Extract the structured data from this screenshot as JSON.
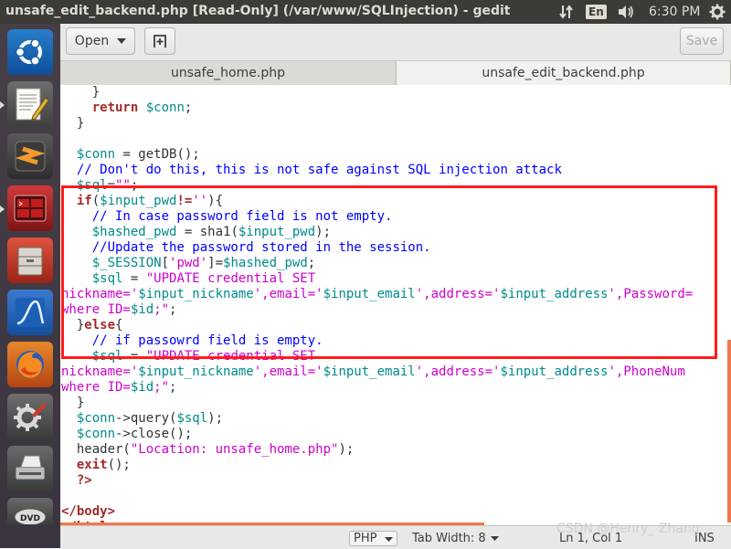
{
  "window": {
    "title": "unsafe_edit_backend.php [Read-Only] (/var/www/SQLInjection) - gedit"
  },
  "tray": {
    "network_icon": "updown-arrows-icon",
    "keyboard_label": "En",
    "volume_icon": "speaker-icon",
    "clock": "6:30 PM",
    "power_icon": "gear-icon"
  },
  "launcher": {
    "items": [
      {
        "name": "ubuntu-dash"
      },
      {
        "name": "text-editor"
      },
      {
        "name": "sublime-text"
      },
      {
        "name": "terminal"
      },
      {
        "name": "files"
      },
      {
        "name": "wireshark"
      },
      {
        "name": "firefox"
      },
      {
        "name": "system-settings"
      },
      {
        "name": "scanner"
      },
      {
        "name": "dvd"
      }
    ]
  },
  "toolbar": {
    "open_label": "Open",
    "new_tab_icon": "new-tab-icon",
    "save_label": "Save"
  },
  "tabs": [
    {
      "label": "unsafe_home.php"
    },
    {
      "label": "unsafe_edit_backend.php"
    }
  ],
  "code_lines": [
    [
      {
        "t": "    }",
        "c": "pl"
      }
    ],
    [
      {
        "t": "    ",
        "c": "pl"
      },
      {
        "t": "return",
        "c": "kw"
      },
      {
        "t": " ",
        "c": "pl"
      },
      {
        "t": "$conn",
        "c": "var"
      },
      {
        "t": ";",
        "c": "pl"
      }
    ],
    [
      {
        "t": "  }",
        "c": "pl"
      }
    ],
    [
      {
        "t": "",
        "c": "pl"
      }
    ],
    [
      {
        "t": "  ",
        "c": "pl"
      },
      {
        "t": "$conn",
        "c": "var"
      },
      {
        "t": " = getDB();",
        "c": "pl"
      }
    ],
    [
      {
        "t": "  ",
        "c": "pl"
      },
      {
        "t": "// Don't do this, this is not safe against SQL injection attack",
        "c": "cm"
      }
    ],
    [
      {
        "t": "  ",
        "c": "pl"
      },
      {
        "t": "$sql",
        "c": "var"
      },
      {
        "t": "=",
        "c": "pl"
      },
      {
        "t": "\"\"",
        "c": "str"
      },
      {
        "t": ";",
        "c": "pl"
      }
    ],
    [
      {
        "t": "  ",
        "c": "pl"
      },
      {
        "t": "if",
        "c": "kw"
      },
      {
        "t": "(",
        "c": "pl"
      },
      {
        "t": "$input_pwd",
        "c": "var"
      },
      {
        "t": "!=",
        "c": "kw"
      },
      {
        "t": "''",
        "c": "str"
      },
      {
        "t": "){",
        "c": "pl"
      }
    ],
    [
      {
        "t": "    ",
        "c": "pl"
      },
      {
        "t": "// In case password field is not empty.",
        "c": "cm"
      }
    ],
    [
      {
        "t": "    ",
        "c": "pl"
      },
      {
        "t": "$hashed_pwd",
        "c": "var"
      },
      {
        "t": " = sha1(",
        "c": "pl"
      },
      {
        "t": "$input_pwd",
        "c": "var"
      },
      {
        "t": ");",
        "c": "pl"
      }
    ],
    [
      {
        "t": "    ",
        "c": "pl"
      },
      {
        "t": "//Update the password stored in the session.",
        "c": "cm"
      }
    ],
    [
      {
        "t": "    ",
        "c": "pl"
      },
      {
        "t": "$_SESSION",
        "c": "var"
      },
      {
        "t": "[",
        "c": "pl"
      },
      {
        "t": "'pwd'",
        "c": "str"
      },
      {
        "t": "]=",
        "c": "pl"
      },
      {
        "t": "$hashed_pwd",
        "c": "var"
      },
      {
        "t": ";",
        "c": "pl"
      }
    ],
    [
      {
        "t": "    ",
        "c": "pl"
      },
      {
        "t": "$sql",
        "c": "var"
      },
      {
        "t": " = ",
        "c": "pl"
      },
      {
        "t": "\"UPDATE credential SET",
        "c": "str"
      }
    ],
    [
      {
        "t": "nickname='",
        "c": "str"
      },
      {
        "t": "$input_nickname",
        "c": "var"
      },
      {
        "t": "',email='",
        "c": "str"
      },
      {
        "t": "$input_email",
        "c": "var"
      },
      {
        "t": "',address='",
        "c": "str"
      },
      {
        "t": "$input_address",
        "c": "var"
      },
      {
        "t": "',Password=",
        "c": "str"
      }
    ],
    [
      {
        "t": "where ID=",
        "c": "str"
      },
      {
        "t": "$id",
        "c": "var"
      },
      {
        "t": ";\"",
        "c": "str"
      },
      {
        "t": ";",
        "c": "pl"
      }
    ],
    [
      {
        "t": "  }",
        "c": "pl"
      },
      {
        "t": "else",
        "c": "kw"
      },
      {
        "t": "{",
        "c": "pl"
      }
    ],
    [
      {
        "t": "    ",
        "c": "pl"
      },
      {
        "t": "// if passowrd field is empty.",
        "c": "cm"
      }
    ],
    [
      {
        "t": "    ",
        "c": "pl"
      },
      {
        "t": "$sql",
        "c": "var"
      },
      {
        "t": " = ",
        "c": "pl"
      },
      {
        "t": "\"UPDATE credential SET",
        "c": "str"
      }
    ],
    [
      {
        "t": "nickname='",
        "c": "str"
      },
      {
        "t": "$input_nickname",
        "c": "var"
      },
      {
        "t": "',email='",
        "c": "str"
      },
      {
        "t": "$input_email",
        "c": "var"
      },
      {
        "t": "',address='",
        "c": "str"
      },
      {
        "t": "$input_address",
        "c": "var"
      },
      {
        "t": "',PhoneNum",
        "c": "str"
      }
    ],
    [
      {
        "t": "where ID=",
        "c": "str"
      },
      {
        "t": "$id",
        "c": "var"
      },
      {
        "t": ";\"",
        "c": "str"
      },
      {
        "t": ";",
        "c": "pl"
      }
    ],
    [
      {
        "t": "  }",
        "c": "pl"
      }
    ],
    [
      {
        "t": "  ",
        "c": "pl"
      },
      {
        "t": "$conn",
        "c": "var"
      },
      {
        "t": "->query(",
        "c": "pl"
      },
      {
        "t": "$sql",
        "c": "var"
      },
      {
        "t": ");",
        "c": "pl"
      }
    ],
    [
      {
        "t": "  ",
        "c": "pl"
      },
      {
        "t": "$conn",
        "c": "var"
      },
      {
        "t": "->close();",
        "c": "pl"
      }
    ],
    [
      {
        "t": "  header(",
        "c": "pl"
      },
      {
        "t": "\"Location: unsafe_home.php\"",
        "c": "str"
      },
      {
        "t": ");",
        "c": "pl"
      }
    ],
    [
      {
        "t": "  ",
        "c": "pl"
      },
      {
        "t": "exit",
        "c": "kw"
      },
      {
        "t": "();",
        "c": "pl"
      }
    ],
    [
      {
        "t": "  ",
        "c": "pl"
      },
      {
        "t": "?>",
        "c": "kw"
      }
    ],
    [
      {
        "t": "",
        "c": "pl"
      }
    ],
    [
      {
        "t": "</body>",
        "c": "kw"
      }
    ],
    [
      {
        "t": "</html>",
        "c": "kw"
      }
    ]
  ],
  "statusbar": {
    "language": "PHP",
    "tab_width": "Tab Width: 8",
    "cursor": "Ln 1, Col 1",
    "mode": "INS"
  },
  "watermark": "CSDN @Henry_ Zhang",
  "colors": {
    "highlight_box": "#ff1b1b",
    "keyword": "#a52a2a",
    "variable": "#008a8c",
    "string": "#cc00cc",
    "comment": "#0000ff"
  }
}
